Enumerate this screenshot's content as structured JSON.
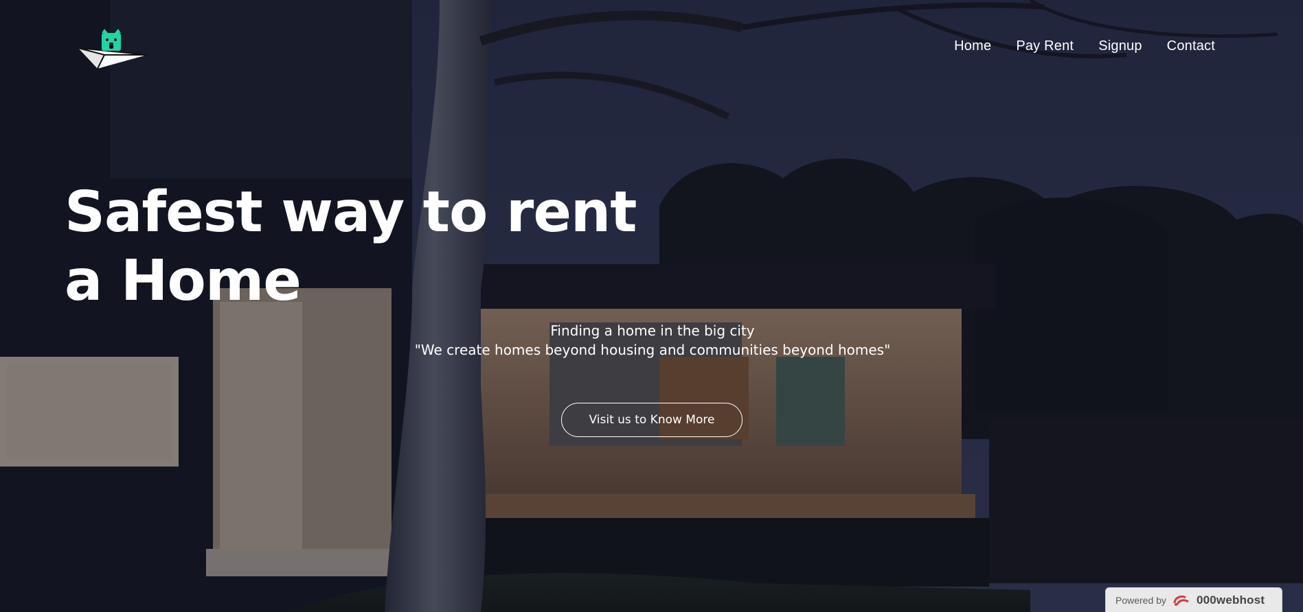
{
  "nav": {
    "items": [
      {
        "label": "Home"
      },
      {
        "label": "Pay Rent"
      },
      {
        "label": "Signup"
      },
      {
        "label": "Contact"
      }
    ]
  },
  "hero": {
    "headline_line1": "Safest way to rent",
    "headline_line2": "a Home",
    "subtitle": "Finding a home in the big city",
    "quote": "\"We create homes beyond housing and communities beyond homes\"",
    "cta_label": "Visit us to Know More"
  },
  "footer_badge": {
    "prefix": "Powered by",
    "brand": "000webhost"
  },
  "icons": {
    "logo": "paper-plane-cat-logo",
    "badge": "webhost-logo-icon"
  },
  "colors": {
    "logo_accent": "#21d3a6",
    "badge_red": "#d63a3a"
  }
}
